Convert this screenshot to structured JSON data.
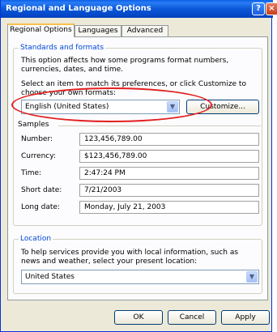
{
  "window": {
    "title": "Regional and Language Options",
    "help_label": "?",
    "close_label": "×"
  },
  "tabs": [
    "Regional Options",
    "Languages",
    "Advanced"
  ],
  "standards": {
    "title": "Standards and formats",
    "desc": "This option affects how some programs format numbers, currencies, dates, and time.",
    "select_text": "Select an item to match its preferences, or click Customize to choose your own formats:",
    "selected_locale": "English (United States)",
    "customize_label": "Customize...",
    "samples_label": "Samples",
    "samples": [
      {
        "label": "Number:",
        "value": "123,456,789.00"
      },
      {
        "label": "Currency:",
        "value": "$123,456,789.00"
      },
      {
        "label": "Time:",
        "value": "2:47:24 PM"
      },
      {
        "label": "Short date:",
        "value": "7/21/2003"
      },
      {
        "label": "Long date:",
        "value": "Monday, July 21, 2003"
      }
    ]
  },
  "location": {
    "title": "Location",
    "desc": "To help services provide you with local information, such as news and weather, select your present location:",
    "selected": "United States"
  },
  "footer": {
    "ok_label": "OK",
    "cancel_label": "Cancel",
    "apply_label": "Apply"
  },
  "colors": {
    "title_bar": "#0a58d8",
    "group_title": "#0046d5",
    "highlight_oval": "#e32020"
  },
  "icons": {
    "combo_arrow": "chevron-down-icon",
    "help": "help-icon",
    "close": "close-icon"
  }
}
